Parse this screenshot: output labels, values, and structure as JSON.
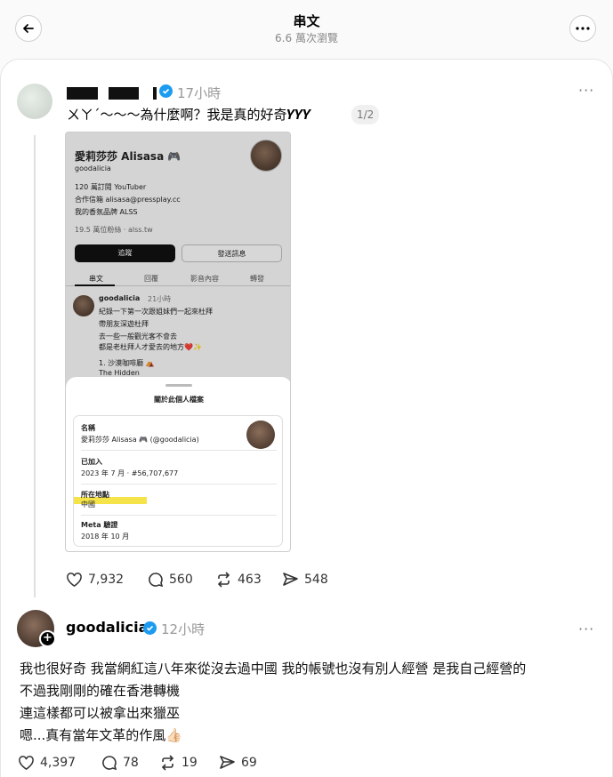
{
  "header": {
    "title": "串文",
    "views": "6.6 萬次瀏覽"
  },
  "post1": {
    "time": "17小時",
    "text": "ㄨㄚˊ～～～為什麼啊？我是真的好奇𝒀𝒀𝒀",
    "page_indicator": "1/2",
    "stats": {
      "likes": "7,932",
      "comments": "560",
      "reposts": "463",
      "shares": "548"
    }
  },
  "embedded_profile": {
    "name": "愛莉莎莎 Alisasa 🎮",
    "handle": "goodalicia",
    "bio": [
      "120 萬訂閱 YouTuber",
      "合作信箱 alisasa@pressplay.cc",
      "我的香氛品牌 ALSS"
    ],
    "followers": "19.5 萬位粉絲 · alss.tw",
    "follow_button": "追蹤",
    "message_button": "發送訊息",
    "tabs": [
      "串文",
      "回覆",
      "影音內容",
      "轉發"
    ],
    "post": {
      "user": "goodalicia",
      "time": "21小時",
      "lines": [
        "紀錄一下第一次跟姐妹們一起來杜拜",
        "帶朋友深遊杜拜",
        "去一些一般觀光客不會去",
        "都是老杜拜人才愛去的地方❤️✨",
        "1. 沙漠咖啡廳 ⛺",
        "The Hidden"
      ]
    },
    "about": {
      "title": "關於此個人檔案",
      "name_label": "名稱",
      "name_value": "愛莉莎莎 Alisasa 🎮 (@goodalicia)",
      "joined_label": "已加入",
      "joined_value": "2023 年 7 月 · #56,707,677",
      "location_label": "所在地點",
      "location_value": "中國",
      "meta_label": "Meta 驗證",
      "meta_value": "2018 年 10 月"
    }
  },
  "post2": {
    "username": "goodalicia",
    "time": "12小時",
    "lines": [
      "我也很好奇 我當網紅這八年來從沒去過中國 我的帳號也沒有別人經營 是我自己經營的",
      "不過我剛剛的確在香港轉機",
      "連這樣都可以被拿出來獵巫",
      "嗯...真有當年文革的作風👍🏻"
    ],
    "stats": {
      "likes": "4,397",
      "comments": "78",
      "reposts": "19",
      "shares": "69"
    }
  },
  "colors": {
    "verified": "#1d9bf0",
    "highlight": "#f5e34a"
  },
  "icons": [
    "back-arrow-icon",
    "more-icon",
    "verified-icon",
    "heart-icon",
    "comment-icon",
    "repost-icon",
    "share-icon",
    "plus-icon"
  ]
}
